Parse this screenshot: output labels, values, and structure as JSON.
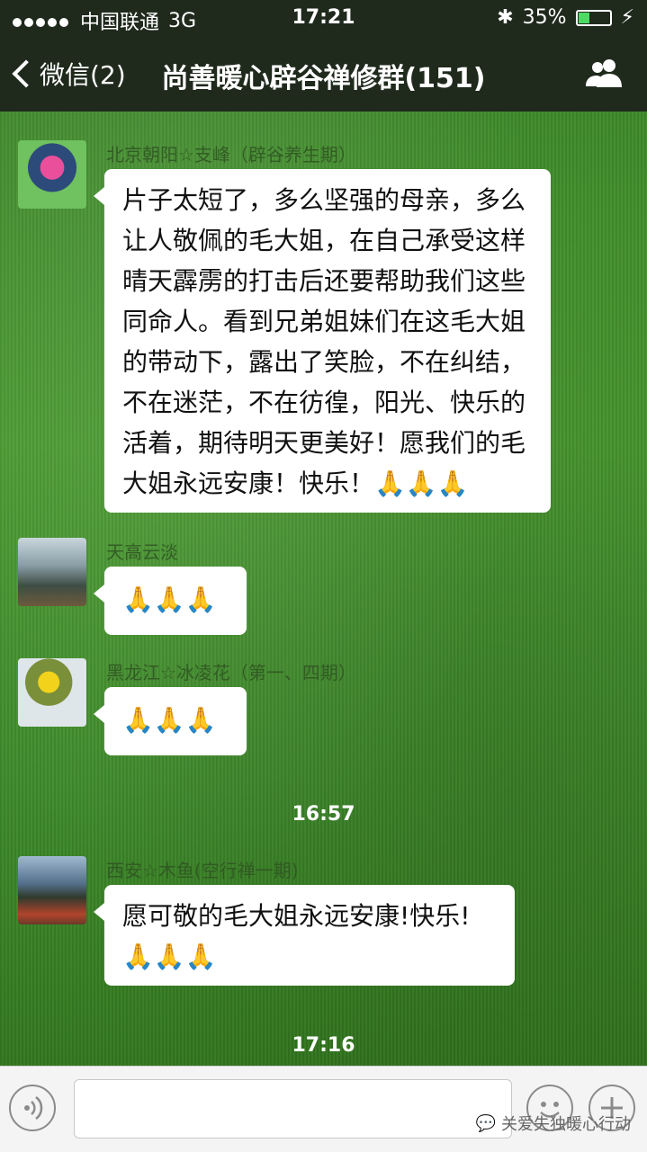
{
  "status_bar": {
    "carrier": "中国联通",
    "network": "3G",
    "time": "17:21",
    "battery_percent": "35%",
    "battery_level": 0.35
  },
  "nav": {
    "back_label": "微信(2)",
    "title": "尚善暖心辟谷禅修群(151)"
  },
  "messages": [
    {
      "sender": "北京朝阳☆支峰（辟谷养生期）",
      "text": "片子太短了，多么坚强的母亲，多么让人敬佩的毛大姐，在自己承受这样晴天霹雳的打击后还要帮助我们这些同命人。看到兄弟姐妹们在这毛大姐的带动下，露出了笑脸，不在纠结，不在迷茫，不在彷徨，阳光、快乐的活着，期待明天更美好！愿我们的毛大姐永远安康！快乐！",
      "emoji": "🙏🙏🙏"
    },
    {
      "sender": "天高云淡",
      "text": "",
      "emoji": "🙏🙏🙏"
    },
    {
      "sender": "黑龙江☆冰凌花（第一、四期）",
      "text": "",
      "emoji": "🙏🙏🙏"
    },
    {
      "sender": "西安☆木鱼(空行禅一期)",
      "text": "愿可敬的毛大姐永远安康!快乐!",
      "emoji": "🙏🙏🙏"
    }
  ],
  "timestamps": [
    "16:57",
    "17:16"
  ],
  "watermark": "关爱失独暖心行动",
  "colors": {
    "topbar": "#1f2a1d",
    "grass": "#3f8a2a",
    "bubble": "#ffffff"
  }
}
